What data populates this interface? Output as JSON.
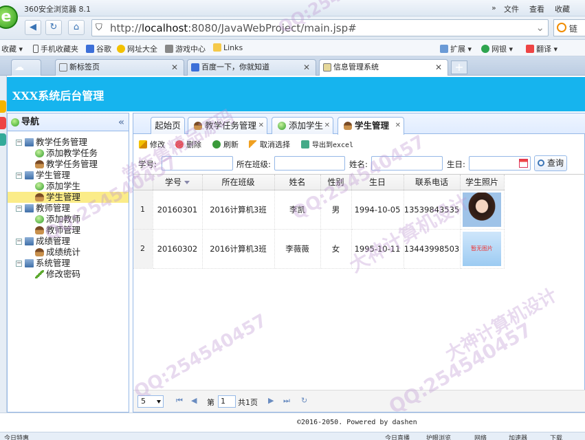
{
  "browser": {
    "title": "360安全浏览器 8.1",
    "menu": [
      "文件",
      "查看",
      "收藏"
    ],
    "url_prefix": "http://",
    "url_host": "localhost",
    "url_rest": ":8080/JavaWebProject/main.jsp#",
    "search_placeholder": "链",
    "bookmarks": [
      "收藏",
      "手机收藏夹",
      "谷歌",
      "网址大全",
      "游戏中心",
      "Links"
    ],
    "bookmarks_right": [
      "扩展",
      "网银",
      "翻译"
    ],
    "tabs": [
      "新标签页",
      "百度一下，你就知道",
      "信息管理系统"
    ]
  },
  "app": {
    "title": "XXX系统后台管理"
  },
  "nav": {
    "title": "导航",
    "collapse": "«",
    "groups": [
      {
        "label": "教学任务管理",
        "items": [
          "添加教学任务",
          "教学任务管理"
        ]
      },
      {
        "label": "学生管理",
        "items": [
          "添加学生",
          "学生管理"
        ]
      },
      {
        "label": "教师管理",
        "items": [
          "添加教师",
          "教师管理"
        ]
      },
      {
        "label": "成绩管理",
        "items": [
          "成绩统计"
        ]
      },
      {
        "label": "系统管理",
        "items": [
          "修改密码"
        ]
      }
    ]
  },
  "tabs": {
    "home": "起始页",
    "items": [
      "教学任务管理",
      "添加学生",
      "学生管理"
    ]
  },
  "toolbar": {
    "edit": "修改",
    "delete": "删除",
    "refresh": "刷新",
    "cancel": "取消选择",
    "export": "导出到excel"
  },
  "filters": {
    "id_label": "学号:",
    "class_label": "所在班级:",
    "name_label": "姓名:",
    "birth_label": "生日:",
    "query": "查询"
  },
  "grid": {
    "columns": [
      "学号",
      "所在班级",
      "姓名",
      "性别",
      "生日",
      "联系电话",
      "学生照片"
    ],
    "rows": [
      {
        "rownum": "1",
        "id": "20160301",
        "class": "2016计算机3班",
        "name": "李凯",
        "gender": "男",
        "birth": "1994-10-05",
        "phone": "13539843535",
        "photo": ""
      },
      {
        "rownum": "2",
        "id": "20160302",
        "class": "2016计算机3班",
        "name": "李薇薇",
        "gender": "女",
        "birth": "1995-10-11",
        "phone": "13443998503",
        "photo": "暂无图片"
      }
    ]
  },
  "pager": {
    "page_size": "5",
    "page_prefix": "第",
    "page": "1",
    "total": "共1页"
  },
  "footer": "©2016-2050. Powered by dashen",
  "status": {
    "left": "今日特惠",
    "right": [
      "今日直播",
      "护眼浏览",
      "网络",
      "加速器",
      "下载"
    ]
  },
  "watermark": {
    "qq": "QQ:254540457",
    "a": "常年售精品源码",
    "b": "大神计算机设计"
  }
}
